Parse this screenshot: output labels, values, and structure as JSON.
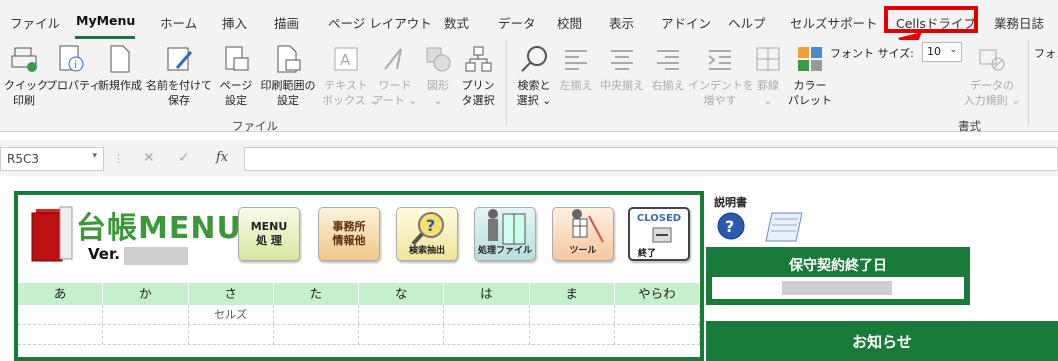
{
  "ribbon_tabs": {
    "file": "ファイル",
    "mymenu": "MyMenu",
    "home": "ホーム",
    "insert": "挿入",
    "draw": "描画",
    "page_layout": "ページ レイアウト",
    "formulas": "数式",
    "data": "データ",
    "review": "校閲",
    "view": "表示",
    "addins": "アドイン",
    "help": "ヘルプ",
    "cells_support": "セルズサポート",
    "cells_drive": "Cellsドライブ",
    "business_diary": "業務日誌"
  },
  "ribbon": {
    "quick_print": [
      "クイック",
      "印刷"
    ],
    "properties": "プロパティ",
    "new": "新規作成",
    "save_as": [
      "名前を付けて",
      "保存"
    ],
    "page_setup": [
      "ページ",
      "設定"
    ],
    "print_area": [
      "印刷範囲の",
      "設定"
    ],
    "textbox": [
      "テキスト",
      "ボックス ⌄"
    ],
    "wordart": [
      "ワード",
      "アート ⌄"
    ],
    "shapes": [
      "図形",
      "⌄"
    ],
    "printer_select": [
      "プリン",
      "タ選択"
    ],
    "find_select": [
      "検索と",
      "選択 ⌄"
    ],
    "align_left": "左揃え",
    "align_center": "中央揃え",
    "align_right": "右揃え",
    "indent": [
      "インデントを",
      "増やす"
    ],
    "borders": [
      "罫線",
      "⌄"
    ],
    "color_palette": [
      "カラー",
      "パレット"
    ],
    "font_size_label": "フォント サイズ:",
    "font_size_value": "10",
    "data_validation": [
      "データの",
      "入力規則 ⌄"
    ],
    "font_cut": "フォント",
    "group_file": "ファイル",
    "group_format": "書式"
  },
  "formula_bar": {
    "name_box": "R5C3",
    "fx": "fx",
    "formula": ""
  },
  "dashboard": {
    "logo_text": "台帳MENU",
    "version_label": "Ver.",
    "buttons": {
      "menu": [
        "MENU",
        "処 理"
      ],
      "office": [
        "事務所",
        "情報他"
      ],
      "search": "検索抽出",
      "process_file": "処理ファイル",
      "tool": "ツール",
      "closed": [
        "CLOSED",
        "終了"
      ]
    },
    "kana_headers": [
      "あ",
      "か",
      "さ",
      "た",
      "な",
      "は",
      "ま",
      "やらわ"
    ],
    "rows": [
      [
        "",
        "",
        "セルズ",
        "",
        "",
        "",
        "",
        ""
      ],
      [
        "",
        "",
        "",
        "",
        "",
        "",
        "",
        ""
      ]
    ]
  },
  "right_panel": {
    "manual_label": "説明書",
    "maintenance_title": "保守契約終了日",
    "notice_title": "お知らせ"
  },
  "colors": {
    "accent_green": "#1a7a3a",
    "kana_bg": "#c6efce",
    "highlight_red": "#e00000"
  }
}
